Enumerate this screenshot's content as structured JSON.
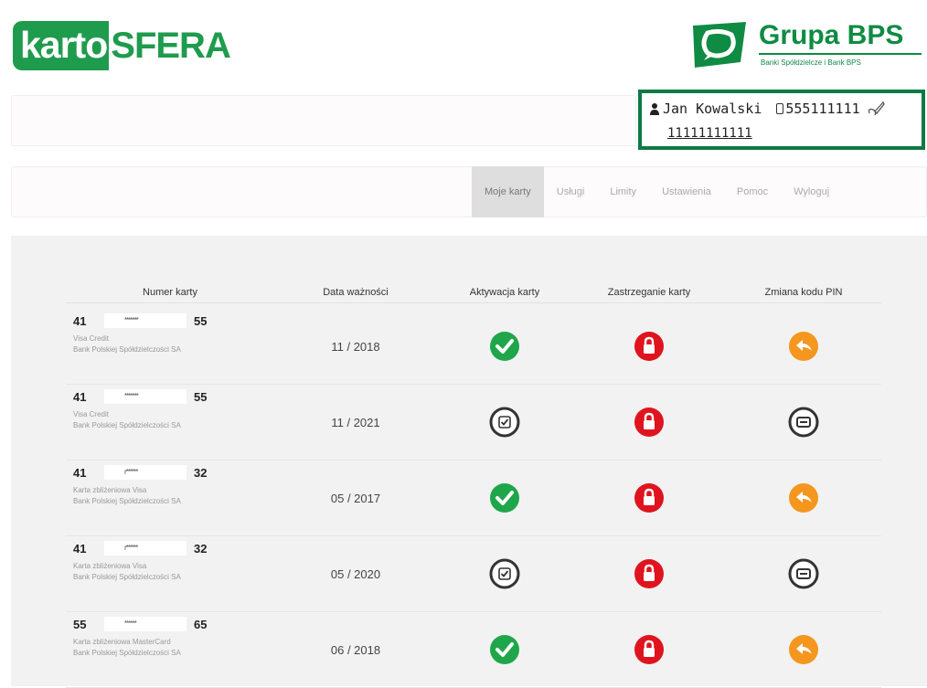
{
  "brand": {
    "karto_a": "karto",
    "karto_b": "SFERA",
    "bps_name": "Grupa BPS",
    "bps_sub": "Banki Spółdzielcze i Bank BPS",
    "accent": "#1f9b4d"
  },
  "user": {
    "name": "Jan Kowalski",
    "phone": "555111111",
    "id": "11111111111"
  },
  "nav": [
    {
      "label": "Moje karty",
      "active": true
    },
    {
      "label": "Usługi",
      "active": false
    },
    {
      "label": "Limity",
      "active": false
    },
    {
      "label": "Ustawienia",
      "active": false
    },
    {
      "label": "Pomoc",
      "active": false
    },
    {
      "label": "Wyloguj",
      "active": false
    }
  ],
  "table": {
    "headers": [
      "Numer karty",
      "Data ważności",
      "Aktywacja karty",
      "Zastrzeganie karty",
      "Zmiana kodu PIN"
    ],
    "rows": [
      {
        "prefix": "41",
        "mask": "*******",
        "suffix": "55",
        "type": "Visa Credit",
        "bank": "Bank Polskiej Spółdzielczości SA",
        "expiry": "11 / 2018",
        "activation": "active",
        "block": "lock",
        "pin": "change"
      },
      {
        "prefix": "41",
        "mask": "*******",
        "suffix": "55",
        "type": "Visa Credit",
        "bank": "Bank Polskiej Spółdzielczości SA",
        "expiry": "11 / 2021",
        "activation": "inactive",
        "block": "lock",
        "pin": "unavailable"
      },
      {
        "prefix": "41",
        "mask": "r******",
        "suffix": "32",
        "type": "Karta zbliżeniowa Visa",
        "bank": "Bank Polskiej Spółdzielczości SA",
        "expiry": "05 / 2017",
        "activation": "active",
        "block": "lock",
        "pin": "change"
      },
      {
        "prefix": "41",
        "mask": "r******",
        "suffix": "32",
        "type": "Karta zbliżeniowa Visa",
        "bank": "Bank Polskiej Spółdzielczości SA",
        "expiry": "05 / 2020",
        "activation": "inactive",
        "block": "lock",
        "pin": "unavailable"
      },
      {
        "prefix": "55",
        "mask": "******",
        "suffix": "65",
        "type": "Karta zbliżeniowa MasterCard",
        "bank": "Bank Polskiej Spółdzielczości SA",
        "expiry": "06 / 2018",
        "activation": "active",
        "block": "lock",
        "pin": "change"
      }
    ]
  },
  "colors": {
    "active_green": "#1fa64a",
    "lock_red": "#e0141e",
    "pin_orange": "#f5961e",
    "neutral_dark": "#333333"
  }
}
